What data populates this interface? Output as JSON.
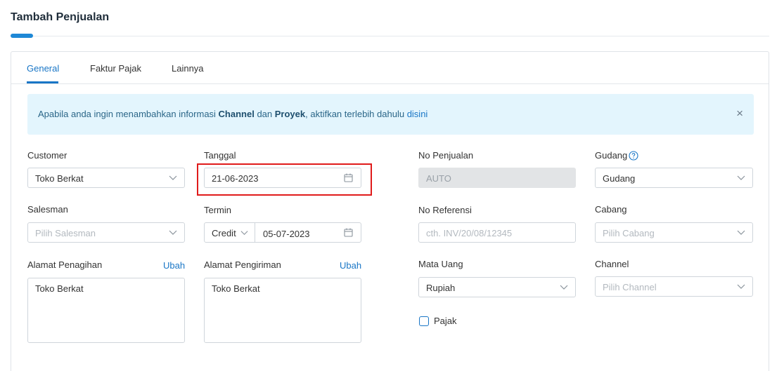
{
  "page": {
    "title": "Tambah Penjualan"
  },
  "tabs": [
    {
      "label": "General",
      "active": true
    },
    {
      "label": "Faktur Pajak",
      "active": false
    },
    {
      "label": "Lainnya",
      "active": false
    }
  ],
  "alert": {
    "text_prefix": "Apabila anda ingin menambahkan informasi ",
    "channel": "Channel",
    "and": " dan ",
    "project": "Proyek",
    "text_middle": ", aktifkan terlebih dahulu ",
    "link": "disini",
    "close": "×"
  },
  "form": {
    "customer": {
      "label": "Customer",
      "value": "Toko Berkat"
    },
    "tanggal": {
      "label": "Tanggal",
      "value": "21-06-2023"
    },
    "no_penjualan": {
      "label": "No Penjualan",
      "value": "AUTO"
    },
    "gudang": {
      "label": "Gudang",
      "value": "Gudang"
    },
    "salesman": {
      "label": "Salesman",
      "placeholder": "Pilih Salesman"
    },
    "termin": {
      "label": "Termin",
      "type_value": "Credit",
      "date_value": "05-07-2023"
    },
    "no_referensi": {
      "label": "No Referensi",
      "placeholder": "cth. INV/20/08/12345"
    },
    "cabang": {
      "label": "Cabang",
      "placeholder": "Pilih Cabang"
    },
    "alamat_penagihan": {
      "label": "Alamat Penagihan",
      "action": "Ubah",
      "value": "Toko Berkat"
    },
    "alamat_pengiriman": {
      "label": "Alamat Pengiriman",
      "action": "Ubah",
      "value": "Toko Berkat"
    },
    "mata_uang": {
      "label": "Mata Uang",
      "value": "Rupiah"
    },
    "channel": {
      "label": "Channel",
      "placeholder": "Pilih Channel"
    },
    "pajak": {
      "label": "Pajak",
      "checked": false
    }
  },
  "colors": {
    "accent": "#1976c6",
    "highlight": "#e01b1b",
    "alert_bg": "#e3f5fd"
  },
  "icons": [
    "chevron-down-icon",
    "calendar-icon",
    "close-icon",
    "help-icon"
  ]
}
